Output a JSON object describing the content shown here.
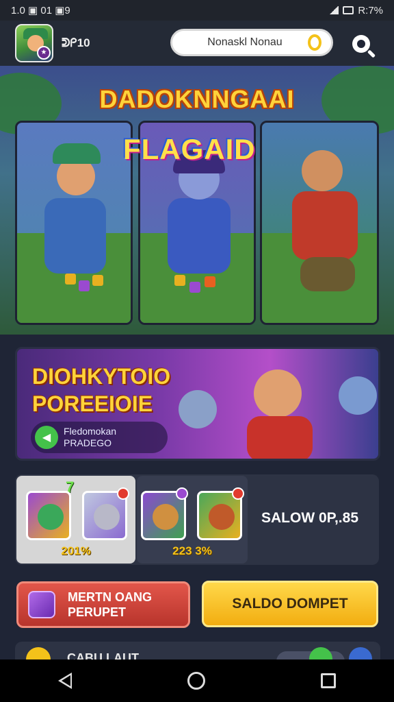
{
  "status_bar": {
    "time_left": "1.0 ▣ 01 ▣9",
    "right": "R:7%"
  },
  "header": {
    "username": "ᕲᑭ10",
    "search_text": "Nonaskl Nonau"
  },
  "hero": {
    "title": "DADOKNNGAAI",
    "card_logo": "FLAGAID"
  },
  "promo": {
    "title_line1": "DIOHKYTOIO",
    "title_line2": "POREEIOIE",
    "pill_line1": "Fledomokan",
    "pill_line2": "PRADEGO"
  },
  "rewards": {
    "bonus": "7",
    "group1_pct": "201%",
    "group2_pct": "223 3%",
    "saldo_label": "SALOW 0P,.85"
  },
  "buttons": {
    "red_label_line1": "MERTN OANG",
    "red_label_line2": "PERUPET",
    "yellow_label": "SALDO DOMPET"
  },
  "bottom_row": {
    "text": "CABU LAUT"
  },
  "colors": {
    "accent_yellow": "#ffd33a",
    "button_red": "#d2463c",
    "button_yellow": "#f8c52a",
    "panel": "#2d3344"
  }
}
